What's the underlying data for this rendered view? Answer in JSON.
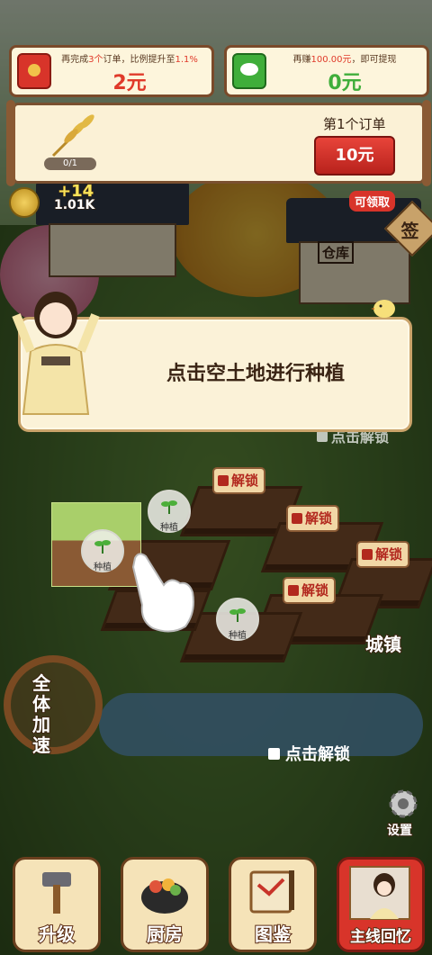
{
  "banners": {
    "left": {
      "text_pre": "再完成",
      "text_count": "3个",
      "text_mid": "订单，比例提升至",
      "text_rate": "1.1%",
      "value": "2元",
      "color": "#e03a2a"
    },
    "right": {
      "text_pre": "再赚",
      "text_amount": "100.00元",
      "text_post": "，即可提现",
      "value": "0元",
      "color": "#3fae3a"
    }
  },
  "order": {
    "progress": "0/1",
    "title": "第1个订单",
    "button": "10元"
  },
  "coins": {
    "gain": "+14",
    "total": "1.01K"
  },
  "claimable_badge": "可领取",
  "sign_label": "签",
  "warehouse_label": "仓库",
  "dialog": {
    "message": "点击空土地进行种植"
  },
  "plant_label": "种植",
  "unlock_label": "解锁",
  "click_unlock": "点击解锁",
  "town_label": "城镇",
  "speed_label": "全体加速",
  "settings_label": "设置",
  "bottom_nav": [
    {
      "label": "升级",
      "icon": "hammer-icon"
    },
    {
      "label": "厨房",
      "icon": "pot-icon"
    },
    {
      "label": "图鉴",
      "icon": "book-icon"
    },
    {
      "label": "主线回忆",
      "icon": "story-portrait-icon"
    }
  ],
  "colors": {
    "accent_red": "#c82a20",
    "accent_green": "#3fae3a",
    "wood": "#7a4a2a"
  }
}
